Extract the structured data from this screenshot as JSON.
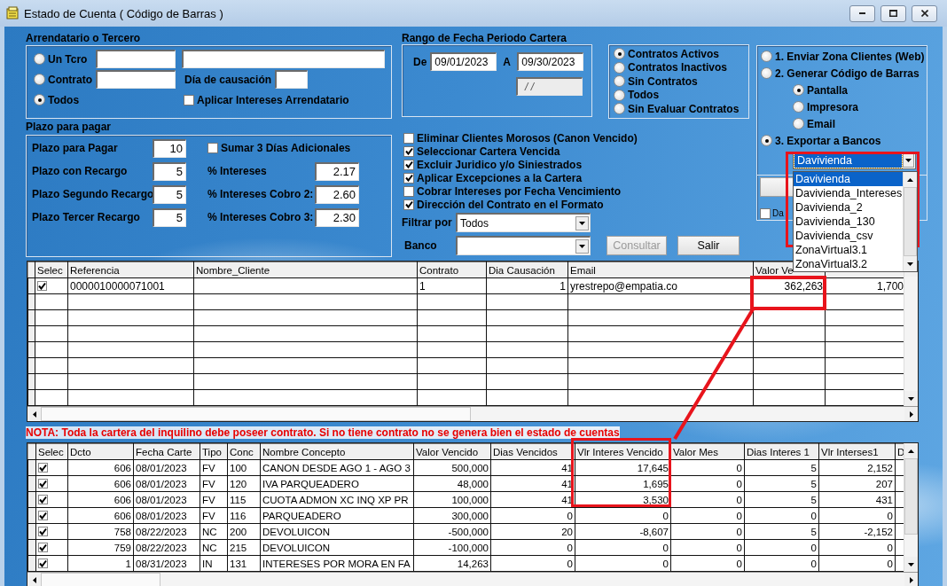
{
  "window": {
    "title": "Estado de Cuenta ( Código de Barras )"
  },
  "arrendatario": {
    "title": "Arrendatario o Tercero",
    "options": [
      {
        "label": "Un Tcro",
        "selected": false
      },
      {
        "label": "Contrato",
        "selected": false
      },
      {
        "label": "Todos",
        "selected": true
      }
    ],
    "dia_causacion_label": "Día de causación",
    "aplicar_intereses": {
      "label": "Aplicar Intereses Arrendatario",
      "checked": false
    }
  },
  "plazo": {
    "title": "Plazo para pagar",
    "fields": [
      {
        "label": "Plazo para Pagar",
        "value": "10"
      },
      {
        "label": "Plazo con Recargo",
        "value": "5"
      },
      {
        "label": "Plazo Segundo Recargo",
        "value": "5"
      },
      {
        "label": "Plazo Tercer Recargo",
        "value": "5"
      }
    ],
    "sumar": {
      "label": "Sumar 3 Días Adicionales",
      "checked": false
    },
    "rates": [
      {
        "label": "% Intereses",
        "value": "2.17"
      },
      {
        "label": "% Intereses Cobro 2:",
        "value": "2.60"
      },
      {
        "label": "% Intereses Cobro 3:",
        "value": "2.30"
      }
    ]
  },
  "rango_fecha": {
    "title": "Rango de Fecha Periodo Cartera",
    "from_label": "De",
    "from": "09/01/2023",
    "to_label": "A",
    "to": "09/30/2023",
    "extra": {
      "value": "/ /",
      "disabled": true
    }
  },
  "contratos": [
    {
      "label": "Contratos Activos",
      "selected": true
    },
    {
      "label": "Contratos Inactivos",
      "selected": false
    },
    {
      "label": "Sin Contratos",
      "selected": false
    },
    {
      "label": "Todos",
      "selected": false
    },
    {
      "label": "Sin Evaluar Contratos",
      "selected": false
    }
  ],
  "opciones": [
    {
      "label": "Eliminar Clientes Morosos (Canon Vencido)",
      "checked": false
    },
    {
      "label": "Seleccionar Cartera Vencida",
      "checked": true
    },
    {
      "label": "Excluir Juridico y/o Siniestrados",
      "checked": true
    },
    {
      "label": "Aplicar Excepciones a la Cartera",
      "checked": true
    },
    {
      "label": "Cobrar Intereses por Fecha Vencimiento",
      "checked": false
    },
    {
      "label": "Dirección del Contrato en el Formato",
      "checked": true
    }
  ],
  "filtrar": {
    "label": "Filtrar por",
    "value": "Todos"
  },
  "banco": {
    "label": "Banco"
  },
  "buttons": [
    {
      "label": "Consultar",
      "disabled": true
    },
    {
      "label": "Salir",
      "disabled": false
    }
  ],
  "exportar": {
    "options": [
      {
        "label": "1. Enviar Zona Clientes (Web)",
        "selected": false
      },
      {
        "label": "2. Generar Código de Barras",
        "selected": false,
        "children": [
          {
            "label": "Pantalla",
            "selected": true
          },
          {
            "label": "Impresora",
            "selected": false
          },
          {
            "label": "Email",
            "selected": false
          }
        ]
      },
      {
        "label": "3. Exportar a Bancos",
        "selected": true
      }
    ],
    "banco": {
      "value": "Davivienda",
      "open": true,
      "items": [
        {
          "label": "Davivienda",
          "selected": true
        },
        {
          "label": "Davivienda_Intereses",
          "selected": false
        },
        {
          "label": "Davivienda_2",
          "selected": false
        },
        {
          "label": "Davivienda_130",
          "selected": false
        },
        {
          "label": "Davivienda_csv",
          "selected": false
        },
        {
          "label": "ZonaVirtual3.1",
          "selected": false
        },
        {
          "label": "ZonaVirtual3.2",
          "selected": false
        }
      ]
    },
    "extra_checkbox": {
      "label": "Da",
      "checked": false
    }
  },
  "clientes_table": {
    "check_column": {
      "label": "Selec"
    },
    "columns": [
      {
        "label": "Referencia",
        "kind": "text"
      },
      {
        "label": "Nombre_Cliente",
        "kind": "text"
      },
      {
        "label": "Contrato",
        "kind": "text"
      },
      {
        "label": "Dia Causación",
        "kind": "number"
      },
      {
        "label": "Email",
        "kind": "text"
      },
      {
        "label": "Valor Ve",
        "kind": "number"
      },
      {
        "kind": "number"
      }
    ],
    "rows": [
      {
        "checked": true,
        "cells": [
          "0000010000071001",
          null,
          "1",
          "1",
          "yrestrepo@empatia.co",
          "362,263",
          "1,700"
        ]
      }
    ]
  },
  "nota": "NOTA: Toda la cartera del inquilino debe poseer contrato. Si no tiene contrato no se genera bien el estado de cuentas",
  "conceptos_table": {
    "check_column": {
      "label": "Selec"
    },
    "columns": [
      {
        "label": "Dcto",
        "kind": "number"
      },
      {
        "label": "Fecha Carte",
        "kind": "text"
      },
      {
        "label": "Tipo",
        "kind": "text"
      },
      {
        "label": "Conc",
        "kind": "text"
      },
      {
        "label": "Nombre Concepto",
        "kind": "text"
      },
      {
        "label": "Valor Vencido",
        "kind": "number"
      },
      {
        "label": "Dias Vencidos",
        "kind": "number"
      },
      {
        "label": "Vlr Interes Vencido",
        "kind": "number"
      },
      {
        "label": "Valor Mes",
        "kind": "number"
      },
      {
        "label": "Dias Interes 1",
        "kind": "number"
      },
      {
        "label": "Vlr Interses1",
        "kind": "number"
      },
      {
        "label": "D",
        "kind": "text"
      }
    ],
    "rows": [
      {
        "checked": true,
        "cells": [
          "606",
          "08/01/2023",
          "FV",
          "100",
          "CANON DESDE AGO 1 - AGO 3",
          "500,000",
          "41",
          "17,645",
          "0",
          "5",
          "2,152"
        ]
      },
      {
        "checked": true,
        "cells": [
          "606",
          "08/01/2023",
          "FV",
          "120",
          "IVA PARQUEADERO",
          "48,000",
          "41",
          "1,695",
          "0",
          "5",
          "207"
        ]
      },
      {
        "checked": true,
        "cells": [
          "606",
          "08/01/2023",
          "FV",
          "115",
          "CUOTA ADMON XC INQ XP PR",
          "100,000",
          "41",
          "3,530",
          "0",
          "5",
          "431"
        ]
      },
      {
        "checked": true,
        "cells": [
          "606",
          "08/01/2023",
          "FV",
          "116",
          "PARQUEADERO",
          "300,000",
          "0",
          "0",
          "0",
          "0",
          "0"
        ]
      },
      {
        "checked": true,
        "cells": [
          "758",
          "08/22/2023",
          "NC",
          "200",
          "DEVOLUICON",
          "-500,000",
          "20",
          "-8,607",
          "0",
          "5",
          "-2,152"
        ]
      },
      {
        "checked": true,
        "cells": [
          "759",
          "08/22/2023",
          "NC",
          "215",
          "DEVOLUICON",
          "-100,000",
          "0",
          "0",
          "0",
          "0",
          "0"
        ]
      },
      {
        "checked": true,
        "cells": [
          "1",
          "08/31/2023",
          "IN",
          "131",
          "INTERESES POR MORA EN FA",
          "14,263",
          "0",
          "0",
          "0",
          "0",
          "0"
        ]
      }
    ]
  }
}
